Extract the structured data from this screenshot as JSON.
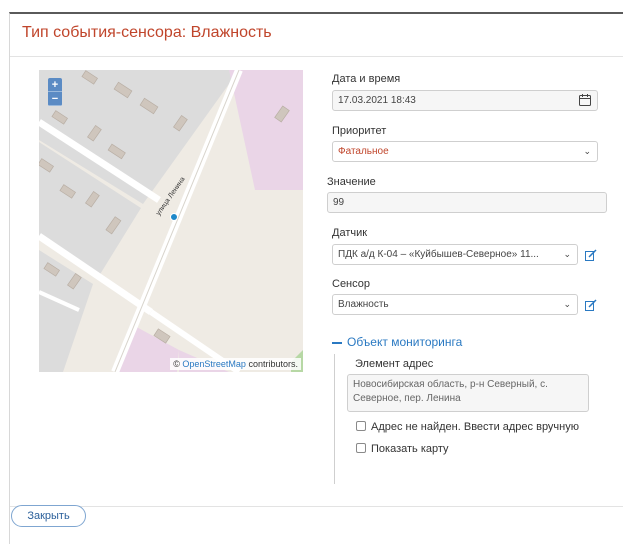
{
  "dialog": {
    "title": "Тип события-сенсора: Влажность",
    "close_label": "Закрыть"
  },
  "map": {
    "zoom_in": "+",
    "zoom_out": "−",
    "street_label": "улица Ленина",
    "attribution_symbol": "©",
    "attribution_link": "OpenStreetMap",
    "attribution_suffix": "contributors."
  },
  "form": {
    "datetime": {
      "label": "Дата и время",
      "value": "17.03.2021 18:43",
      "icon": "calendar-icon"
    },
    "priority": {
      "label": "Приоритет",
      "value": "Фатальное",
      "color": "#c0452b"
    },
    "value": {
      "label": "Значение",
      "value": "99"
    },
    "detector": {
      "label": "Датчик",
      "value": "ПДК а/д К-04 – «Куйбышев-Северное» 11..."
    },
    "sensor": {
      "label": "Сенсор",
      "value": "Влажность"
    },
    "monitoring": {
      "title": "Объект мониторинга",
      "address_label": "Элемент адрес",
      "address_value": "Новосибирская область, р-н Северный, с. Северное, пер. Ленина",
      "address_not_found": "Адрес не найден. Ввести адрес вручную",
      "show_map": "Показать карту"
    }
  },
  "colors": {
    "accent": "#2a79c2",
    "title": "#c0452b"
  }
}
